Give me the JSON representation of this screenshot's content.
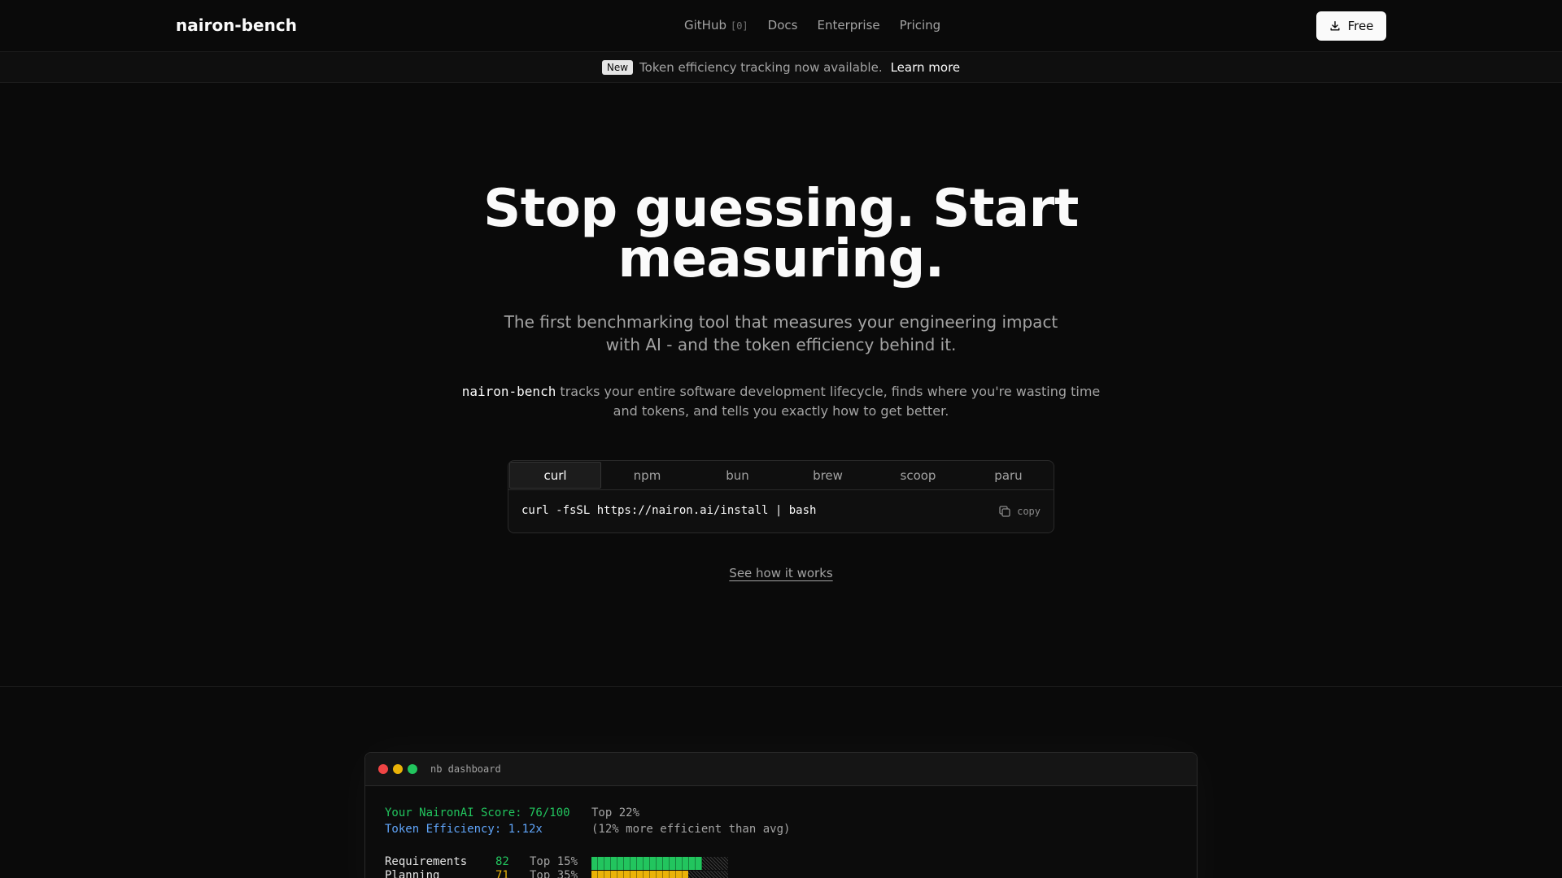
{
  "nav": {
    "brand": "nairon-bench",
    "links": [
      "GitHub",
      "Docs",
      "Enterprise",
      "Pricing"
    ],
    "github_count": "[0]",
    "cta_label": "Free"
  },
  "announcement": {
    "badge": "New",
    "text": "Token efficiency tracking now available.",
    "link": "Learn more"
  },
  "hero": {
    "title_line1": "Stop guessing. Start",
    "title_line2": "measuring.",
    "subtitle": "The first benchmarking tool that measures your engineering impact with AI - and the token efficiency behind it.",
    "desc_name": "nairon-bench",
    "desc_text": " tracks your entire software development lifecycle, finds where you're wasting time and tokens, and tells you exactly how to get better."
  },
  "install": {
    "tabs": [
      "curl",
      "npm",
      "bun",
      "brew",
      "scoop",
      "paru"
    ],
    "active_tab": "curl",
    "command": "curl -fsSL https://nairon.ai/install | bash",
    "copy_label": "copy"
  },
  "see_how": "See how it works",
  "terminal": {
    "title": "nb dashboard",
    "score_line": "Your NaironAI Score: 76/100",
    "score_rank": "Top 22%",
    "efficiency_line": "Token Efficiency: 1.12x",
    "efficiency_note": "(12% more efficient than avg)",
    "rows": [
      {
        "label": "Requirements",
        "score": "82",
        "rank": "Top 15%",
        "fill": 0.82,
        "color": "#22c55e"
      },
      {
        "label": "Planning",
        "score": "71",
        "rank": "Top 35%",
        "fill": 0.71,
        "color": "#eab308"
      }
    ]
  },
  "colors": {
    "accent_green": "#22c55e",
    "accent_blue": "#60a5fa",
    "accent_yellow": "#eab308",
    "dot_red": "#ef4444",
    "dot_yellow": "#eab308",
    "dot_green": "#22c55e"
  }
}
